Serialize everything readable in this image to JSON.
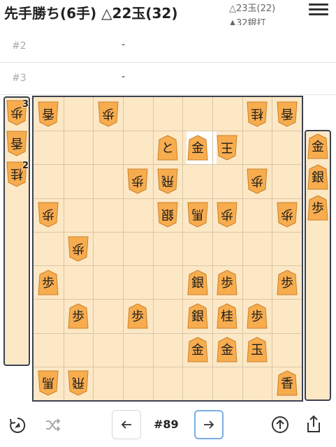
{
  "header": {
    "title": "先手勝ち(6手) △22玉(32)",
    "hint_1": "△23玉(22)",
    "hint_2": "▲32銀打"
  },
  "branches": [
    {
      "num": "#2",
      "value": "-"
    },
    {
      "num": "#3",
      "value": "-"
    }
  ],
  "hands": {
    "gote": [
      {
        "kanji": "歩",
        "count": "3"
      },
      {
        "kanji": "香",
        "count": ""
      },
      {
        "kanji": "桂",
        "count": "2"
      }
    ],
    "sente": [
      {
        "kanji": "金",
        "count": ""
      },
      {
        "kanji": "銀",
        "count": ""
      },
      {
        "kanji": "歩",
        "count": ""
      }
    ]
  },
  "board": {
    "last_move_square": "3二",
    "pieces": [
      {
        "square": "9一",
        "kanji": "香",
        "owner": "gote"
      },
      {
        "square": "7一",
        "kanji": "歩",
        "owner": "gote"
      },
      {
        "square": "2一",
        "kanji": "桂",
        "owner": "gote"
      },
      {
        "square": "1一",
        "kanji": "香",
        "owner": "gote"
      },
      {
        "square": "5二",
        "kanji": "と",
        "owner": "sente"
      },
      {
        "square": "4二",
        "kanji": "金",
        "owner": "sente"
      },
      {
        "square": "3二",
        "kanji": "王",
        "owner": "gote"
      },
      {
        "square": "6三",
        "kanji": "歩",
        "owner": "gote"
      },
      {
        "square": "5三",
        "kanji": "飛",
        "owner": "gote"
      },
      {
        "square": "2三",
        "kanji": "歩",
        "owner": "gote"
      },
      {
        "square": "9四",
        "kanji": "歩",
        "owner": "gote"
      },
      {
        "square": "5四",
        "kanji": "銀",
        "owner": "gote"
      },
      {
        "square": "4四",
        "kanji": "馬",
        "owner": "gote"
      },
      {
        "square": "3四",
        "kanji": "歩",
        "owner": "gote"
      },
      {
        "square": "1四",
        "kanji": "歩",
        "owner": "gote"
      },
      {
        "square": "8五",
        "kanji": "歩",
        "owner": "gote"
      },
      {
        "square": "9六",
        "kanji": "歩",
        "owner": "sente"
      },
      {
        "square": "4六",
        "kanji": "銀",
        "owner": "sente"
      },
      {
        "square": "3六",
        "kanji": "歩",
        "owner": "sente"
      },
      {
        "square": "1六",
        "kanji": "歩",
        "owner": "sente"
      },
      {
        "square": "8七",
        "kanji": "歩",
        "owner": "sente"
      },
      {
        "square": "6七",
        "kanji": "歩",
        "owner": "sente"
      },
      {
        "square": "4七",
        "kanji": "銀",
        "owner": "sente"
      },
      {
        "square": "3七",
        "kanji": "桂",
        "owner": "sente"
      },
      {
        "square": "2七",
        "kanji": "歩",
        "owner": "sente"
      },
      {
        "square": "4八",
        "kanji": "金",
        "owner": "sente"
      },
      {
        "square": "3八",
        "kanji": "金",
        "owner": "sente"
      },
      {
        "square": "2八",
        "kanji": "玉",
        "owner": "sente"
      },
      {
        "square": "9九",
        "kanji": "馬",
        "owner": "gote"
      },
      {
        "square": "8九",
        "kanji": "飛",
        "owner": "gote"
      },
      {
        "square": "1九",
        "kanji": "香",
        "owner": "sente"
      }
    ]
  },
  "toolbar": {
    "move_number": "#89",
    "rotate_icon": "rotate-board-icon",
    "shuffle_icon": "shuffle-icon",
    "prev_icon": "arrow-left-icon",
    "next_icon": "arrow-right-icon",
    "up_icon": "arrow-up-circle-icon",
    "share_icon": "share-icon"
  },
  "colors": {
    "board": "#fde8c6",
    "grid": "#d7c6a9",
    "border": "#3a4150",
    "piece": "#f7ac4e",
    "piece_edge": "#c9822c",
    "active_button": "#7aaee6"
  }
}
